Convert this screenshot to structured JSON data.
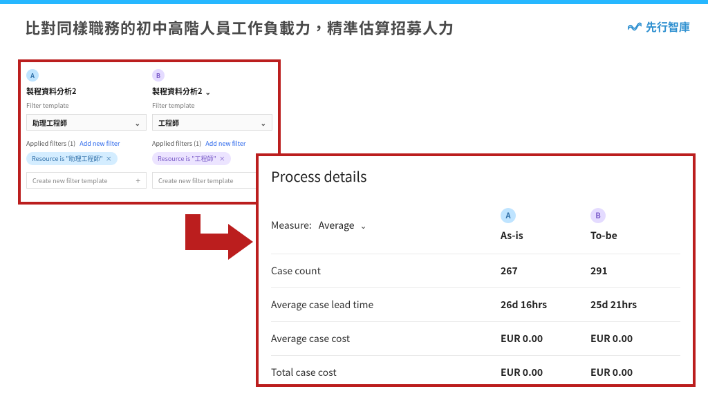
{
  "page": {
    "title": "比對同樣職務的初中高階人員工作負載力，精準估算招募人力"
  },
  "brand": {
    "name": "先行智庫"
  },
  "filters": {
    "filterTemplateLabel": "Filter template",
    "appliedFiltersLabel": "Applied filters (1)",
    "addNewFilterLabel": "Add new filter",
    "createTemplateLabel": "Create new filter template",
    "columns": [
      {
        "badge": "A",
        "procTitle": "製程資料分析2",
        "select": "助理工程師",
        "tag": "Resource is \"助理工程師\""
      },
      {
        "badge": "B",
        "procTitle": "製程資料分析2",
        "select": "工程師",
        "tag": "Resource is \"工程師\""
      }
    ]
  },
  "details": {
    "title": "Process details",
    "measureLabel": "Measure:",
    "measureValue": "Average",
    "columns": [
      {
        "badge": "A",
        "label": "As-is"
      },
      {
        "badge": "B",
        "label": "To-be"
      }
    ],
    "rows": [
      {
        "name": "Case count",
        "a": "267",
        "b": "291"
      },
      {
        "name": "Average case lead time",
        "a": "26d 16hrs",
        "b": "25d 21hrs"
      },
      {
        "name": "Average case cost",
        "a": "EUR 0.00",
        "b": "EUR 0.00"
      },
      {
        "name": "Total case cost",
        "a": "EUR 0.00",
        "b": "EUR 0.00"
      }
    ]
  }
}
